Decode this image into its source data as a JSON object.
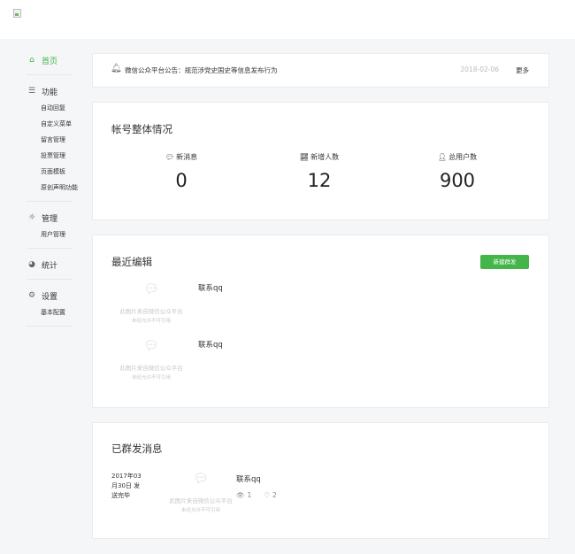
{
  "sidebar": {
    "groups": [
      {
        "label": "首页",
        "icon": "home-icon",
        "active": true,
        "items": []
      },
      {
        "label": "功能",
        "icon": "menu-icon",
        "active": false,
        "items": [
          "自动回复",
          "自定义菜单",
          "留言管理",
          "投票管理",
          "页面模板",
          "原创声明功能"
        ]
      },
      {
        "label": "管理",
        "icon": "sun-icon",
        "active": false,
        "items": [
          "用户管理"
        ]
      },
      {
        "label": "统计",
        "icon": "pie-chart-icon",
        "active": false,
        "items": []
      },
      {
        "label": "设置",
        "icon": "gears-icon",
        "active": false,
        "items": [
          "基本配置"
        ]
      }
    ]
  },
  "notice": {
    "text": "微信公众平台公告：规范涉党史国史等信息发布行为",
    "date": "2018-02-06",
    "more": "更多"
  },
  "overview": {
    "title": "帐号整体情况",
    "stats": [
      {
        "label": "新消息",
        "icon": "chat-bubble-icon",
        "value": "0"
      },
      {
        "label": "新增人数",
        "icon": "trend-icon",
        "value": "12"
      },
      {
        "label": "总用户数",
        "icon": "user-icon",
        "value": "900"
      }
    ]
  },
  "recent": {
    "title": "最近编辑",
    "new_button": "新建群发",
    "items": [
      {
        "title": "联系qq",
        "thumb_line1": "此图片来自微信公众平台",
        "thumb_line2": "未经允许不可引用"
      },
      {
        "title": "联系qq",
        "thumb_line1": "此图片来自微信公众平台",
        "thumb_line2": "未经允许不可引用"
      }
    ]
  },
  "sent": {
    "title": "已群发消息",
    "date_line1": "2017年03",
    "date_line2": "月30日 发",
    "date_line3": "送完毕",
    "thumb_line1": "此图片来自微信公众平台",
    "thumb_line2": "未经允许不可引用",
    "msg_title": "联系qq",
    "views": "1",
    "likes": "2"
  },
  "colors": {
    "accent": "#44b549",
    "background": "#f5f6f8"
  }
}
